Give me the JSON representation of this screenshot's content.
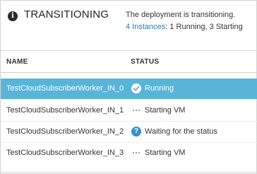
{
  "header": {
    "state": "TRANSITIONING",
    "message": "The deployment is transitioning.",
    "instances_link": "4 Instances",
    "instances_detail": ": 1 Running, 3 Starting"
  },
  "table": {
    "columns": [
      "NAME",
      "STATUS"
    ],
    "rows": [
      {
        "name": "TestCloudSubscriberWorker_IN_0",
        "status": "Running",
        "icon": "check-icon",
        "selected": true
      },
      {
        "name": "TestCloudSubscriberWorker_IN_1",
        "status": "Starting VM",
        "icon": "progress-dots-icon",
        "selected": false
      },
      {
        "name": "TestCloudSubscriberWorker_IN_2",
        "status": "Waiting for the status",
        "icon": "question-icon",
        "selected": false
      },
      {
        "name": "TestCloudSubscriberWorker_IN_3",
        "status": "Starting VM",
        "icon": "progress-dots-icon",
        "selected": false
      }
    ]
  },
  "colors": {
    "selected_row": "#59b4d9",
    "link": "#2a7bbf",
    "question_icon": "#3a8fd0"
  }
}
